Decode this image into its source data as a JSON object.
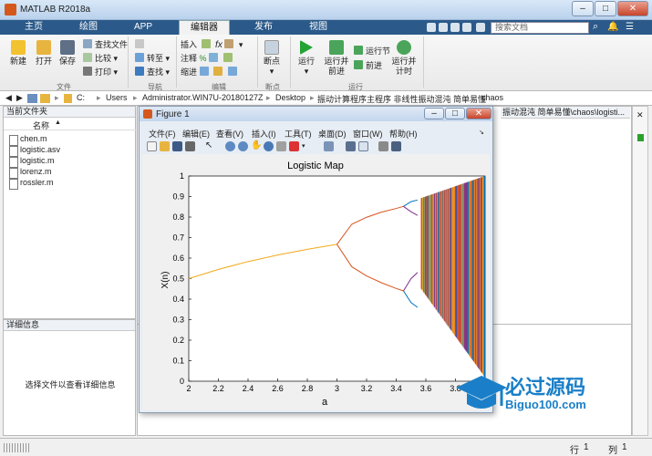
{
  "window": {
    "title": "MATLAB R2018a"
  },
  "tabs": [
    {
      "label": "主页"
    },
    {
      "label": "绘图"
    },
    {
      "label": "APP"
    },
    {
      "label": "编辑器"
    },
    {
      "label": "发布"
    },
    {
      "label": "视图"
    }
  ],
  "search": {
    "placeholder": "搜索文档"
  },
  "ribbon": {
    "file": {
      "new": "新建",
      "open": "打开",
      "save": "保存",
      "find_files": "查找文件",
      "compare": "比较",
      "print": "打印",
      "group": "文件"
    },
    "nav": {
      "goto": "转至",
      "find": "查找",
      "group": "导航"
    },
    "edit": {
      "insert": "插入",
      "comment": "注释",
      "indent": "缩进",
      "group": "编辑"
    },
    "breakpoints": {
      "label": "断点",
      "group": "断点"
    },
    "run": {
      "run": "运行",
      "run_advance_1": "运行并",
      "run_advance_2": "前进",
      "run_section": "运行节",
      "advance": "前进",
      "run_time_1": "运行并",
      "run_time_2": "计时",
      "group": "运行"
    }
  },
  "address": {
    "parts": [
      "C:",
      "Users",
      "Administrator.WIN7U-20180127Z",
      "Desktop",
      "振动计算程序主程序 非线性振动混沌 简单易懂",
      "chaos"
    ],
    "overflow": "振动混沌 简单易懂\\chaos\\logisti..."
  },
  "file_panel": {
    "title": "当前文件夹",
    "column": "名称",
    "files": [
      "chen.m",
      "logistic.asv",
      "logistic.m",
      "lorenz.m",
      "rossler.m"
    ]
  },
  "details_panel": {
    "title": "详细信息",
    "hint": "选择文件以查看详细信息"
  },
  "figure": {
    "title": "Figure 1",
    "menu": [
      "文件(F)",
      "编辑(E)",
      "查看(V)",
      "插入(I)",
      "工具(T)",
      "桌面(D)",
      "窗口(W)",
      "帮助(H)"
    ]
  },
  "statusbar": {
    "row_label": "行",
    "row": "1",
    "col_label": "列",
    "col": "1"
  },
  "watermark": {
    "title": "必过源码",
    "site": "Biguo100.com"
  },
  "colors": {
    "accent": "#2b5a8a",
    "series": [
      "#f2a91a",
      "#d9531e",
      "#0072bd",
      "#7e2f8e"
    ]
  },
  "chart_data": {
    "type": "scatter",
    "title": "Logistic Map",
    "xlabel": "a",
    "ylabel": "X(n)",
    "xlim": [
      2,
      4
    ],
    "ylim": [
      0,
      1
    ],
    "xticks": [
      "2",
      "2.2",
      "2.4",
      "2.6",
      "2.8",
      "3",
      "3.2",
      "3.4",
      "3.6",
      "3.8"
    ],
    "yticks": [
      "0",
      "0.1",
      "0.2",
      "0.3",
      "0.4",
      "0.5",
      "0.6",
      "0.7",
      "0.8",
      "0.9",
      "1"
    ],
    "fixed_point": {
      "x": [
        2.0,
        2.2,
        2.4,
        2.6,
        2.8,
        3.0
      ],
      "y": [
        0.5,
        0.545,
        0.583,
        0.615,
        0.643,
        0.667
      ]
    },
    "period2": {
      "x": [
        3.0,
        3.1,
        3.2,
        3.3,
        3.4,
        3.449
      ],
      "upper": [
        0.667,
        0.765,
        0.799,
        0.824,
        0.842,
        0.852
      ],
      "lower": [
        0.667,
        0.558,
        0.513,
        0.48,
        0.452,
        0.44
      ]
    },
    "chaos_region": {
      "x": [
        3.57,
        4.0
      ],
      "y": [
        0.0,
        1.0
      ]
    },
    "grid": false
  }
}
